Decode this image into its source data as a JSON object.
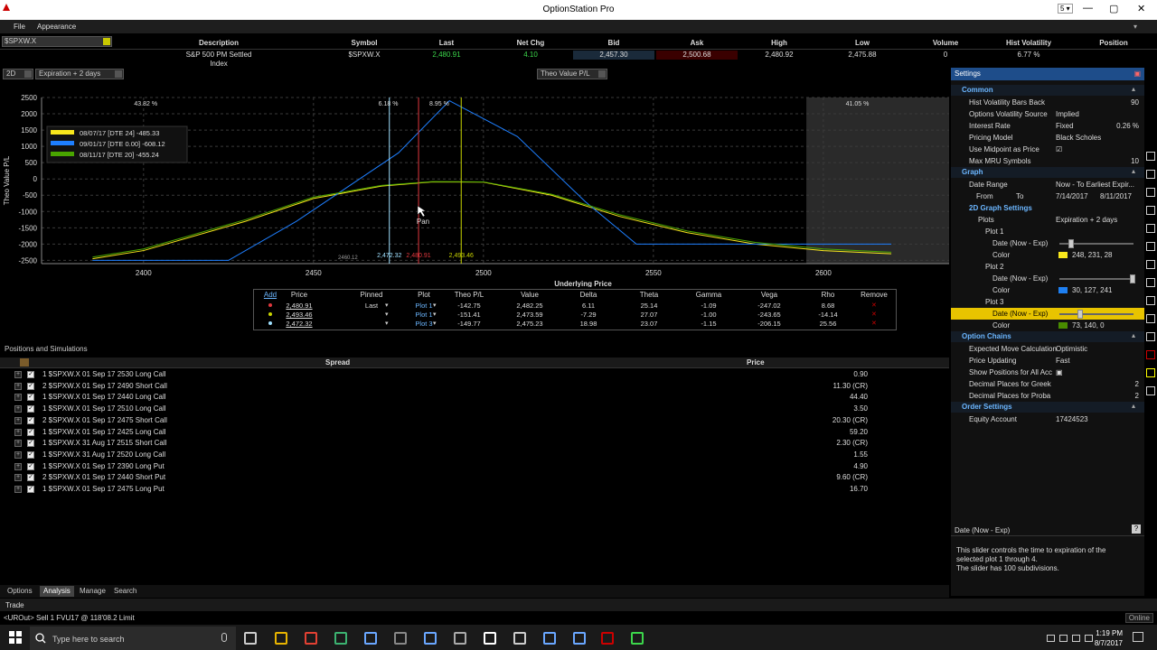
{
  "window": {
    "title": "OptionStation Pro",
    "controls": [
      "5 ▾",
      "—",
      "▢",
      "✕"
    ]
  },
  "menu": {
    "file": "File",
    "appearance": "Appearance"
  },
  "quote": {
    "symbol_select": "$SPXW.X",
    "headers": [
      "Description",
      "Symbol",
      "Last",
      "Net Chg",
      "Bid",
      "Ask",
      "High",
      "Low",
      "Volume",
      "Hist Volatility",
      "Position"
    ],
    "values": [
      "S&P 500 PM Settled Index",
      "$SPXW.X",
      "2,480.91",
      "4.10",
      "2,457.30",
      "2,500.68",
      "2,480.92",
      "2,475.88",
      "0",
      "6.77 %",
      ""
    ]
  },
  "toolbar": {
    "mode": "2D",
    "expiration": "Expiration + 2 days",
    "yaxis_select": "Theo Value P/L"
  },
  "chart_data": {
    "type": "line",
    "ylabel": "Theo Value P/L",
    "xlabel": "Underlying Price",
    "xlim": [
      2370,
      2637
    ],
    "ylim": [
      -2600,
      2500
    ],
    "yticks": [
      2500,
      2000,
      1500,
      1000,
      500,
      0,
      -500,
      -1000,
      -1500,
      -2000,
      -2500
    ],
    "xticks": [
      2400,
      2450,
      2500,
      2550,
      2600
    ],
    "series": [
      {
        "name": "08/07/17 [DTE 24] -485.33",
        "color": "#f8e71c",
        "x": [
          2385,
          2400,
          2430,
          2450,
          2470,
          2485,
          2500,
          2520,
          2540,
          2560,
          2580,
          2600,
          2620
        ],
        "y": [
          -2450,
          -2200,
          -1300,
          -600,
          -220,
          -90,
          -100,
          -500,
          -1150,
          -1650,
          -2000,
          -2200,
          -2300
        ]
      },
      {
        "name": "09/01/17 [DTE 0.00] -608.12",
        "color": "#1e7fff",
        "x": [
          2385,
          2410,
          2425,
          2445,
          2475,
          2490,
          2510,
          2530,
          2545,
          2600,
          2620
        ],
        "y": [
          -2500,
          -2500,
          -2500,
          -1300,
          800,
          2400,
          1300,
          -700,
          -2000,
          -2000,
          -2000
        ]
      },
      {
        "name": "08/11/17 [DTE 20] -455.24",
        "color": "#49a500",
        "x": [
          2385,
          2400,
          2430,
          2450,
          2470,
          2485,
          2500,
          2520,
          2540,
          2560,
          2580,
          2600,
          2620
        ],
        "y": [
          -2400,
          -2150,
          -1250,
          -560,
          -200,
          -80,
          -90,
          -470,
          -1100,
          -1600,
          -1950,
          -2150,
          -2250
        ]
      }
    ],
    "prob_labels": [
      {
        "x": 2390,
        "text": "43.82 %"
      },
      {
        "x": 2472,
        "text": "6.18 %"
      },
      {
        "x": 2487,
        "text": "8.95 %"
      },
      {
        "x": 2610,
        "text": "41.05 %"
      }
    ],
    "vlines": [
      {
        "x": 2472.32,
        "color": "#9fe0ff",
        "label": "2,472.32"
      },
      {
        "x": 2480.91,
        "color": "#e0383e",
        "label": "2,480.91"
      },
      {
        "x": 2493.46,
        "color": "#c8d400",
        "label": "2,493.46"
      }
    ],
    "min_marker": "2460.12",
    "shade_from": 2595,
    "pan_label": "Pan"
  },
  "price_table": {
    "headers": [
      "Add",
      "Price",
      "Pinned",
      "Plot",
      "Theo P/L",
      "Value",
      "Delta",
      "Theta",
      "Gamma",
      "Vega",
      "Rho",
      "Remove"
    ],
    "rows": [
      {
        "dot": "#e0383e",
        "price": "2,480.91",
        "pinned": "Last",
        "plot": "Plot 1",
        "theo": "-142.75",
        "value": "2,482.25",
        "delta": "6.11",
        "theta": "25.14",
        "gamma": "-1.09",
        "vega": "-247.02",
        "rho": "8.68"
      },
      {
        "dot": "#c8d400",
        "price": "2,493.46",
        "pinned": "",
        "plot": "Plot 1",
        "theo": "-151.41",
        "value": "2,473.59",
        "delta": "-7.29",
        "theta": "27.07",
        "gamma": "-1.00",
        "vega": "-243.65",
        "rho": "-14.14"
      },
      {
        "dot": "#9fe0ff",
        "price": "2,472.32",
        "pinned": "",
        "plot": "Plot 3",
        "theo": "-149.77",
        "value": "2,475.23",
        "delta": "18.98",
        "theta": "23.07",
        "gamma": "-1.15",
        "vega": "-206.15",
        "rho": "25.56"
      }
    ]
  },
  "positions": {
    "title": "Positions and Simulations",
    "col_spread": "Spread",
    "col_price": "Price",
    "rows": [
      {
        "label": "1 $SPXW.X 01 Sep 17 2530 Long Call",
        "price": "0.90"
      },
      {
        "label": "2 $SPXW.X 01 Sep 17 2490 Short Call",
        "price": "11.30 (CR)"
      },
      {
        "label": "1 $SPXW.X 01 Sep 17 2440 Long Call",
        "price": "44.40"
      },
      {
        "label": "1 $SPXW.X 01 Sep 17 2510 Long Call",
        "price": "3.50"
      },
      {
        "label": "2 $SPXW.X 01 Sep 17 2475 Short Call",
        "price": "20.30 (CR)"
      },
      {
        "label": "1 $SPXW.X 01 Sep 17 2425 Long Call",
        "price": "59.20"
      },
      {
        "label": "1 $SPXW.X 31 Aug 17 2515 Short Call",
        "price": "2.30 (CR)"
      },
      {
        "label": "1 $SPXW.X 31 Aug 17 2520 Long Call",
        "price": "1.55"
      },
      {
        "label": "1 $SPXW.X 01 Sep 17 2390 Long Put",
        "price": "4.90"
      },
      {
        "label": "2 $SPXW.X 01 Sep 17 2440 Short Put",
        "price": "9.60 (CR)"
      },
      {
        "label": "1 $SPXW.X 01 Sep 17 2475 Long Put",
        "price": "16.70"
      }
    ]
  },
  "settings": {
    "title": "Settings",
    "common": "Common",
    "hist_bars_back": {
      "k": "Hist Volatility Bars Back",
      "v": "90"
    },
    "vol_source": {
      "k": "Options Volatility Source",
      "v": "Implied"
    },
    "interest_rate": {
      "k": "Interest Rate",
      "v": "Fixed",
      "v2": "0.26 %"
    },
    "pricing_model": {
      "k": "Pricing Model",
      "v": "Black Scholes"
    },
    "use_midpoint": {
      "k": "Use Midpoint as Price",
      "v": "☑"
    },
    "max_mru": {
      "k": "Max MRU Symbols",
      "v": "10"
    },
    "graph": "Graph",
    "date_range": {
      "k": "Date Range",
      "v": "Now - To Earliest Expir..."
    },
    "from_to": {
      "k": "From",
      "k2": "To",
      "v": "7/14/2017",
      "v2": "8/11/2017"
    },
    "graph2d": {
      "k": "2D Graph Settings"
    },
    "plots": {
      "k": "Plots",
      "v": "Expiration + 2 days"
    },
    "plot1": "Plot 1",
    "plot2": "Plot 2",
    "plot3": "Plot 3",
    "date_now_exp": "Date (Now - Exp)",
    "color": "Color",
    "plot1_color": {
      "v": "248, 231, 28",
      "hex": "#f8e71c"
    },
    "plot2_color": {
      "v": "30, 127, 241",
      "hex": "#1e7ff1"
    },
    "plot3_color": {
      "v": "73, 140, 0",
      "hex": "#498c00"
    },
    "option_chains": "Option Chains",
    "expected_move": {
      "k": "Expected Move Calculation",
      "v": "Optimistic"
    },
    "price_updating": {
      "k": "Price Updating",
      "v": "Fast"
    },
    "show_positions": {
      "k": "Show Positions for All Acc",
      "v": "▣"
    },
    "dec_greek": {
      "k": "Decimal Places for Greek",
      "v": "2"
    },
    "dec_prob": {
      "k": "Decimal Places for Proba",
      "v": "2"
    },
    "order_settings": "Order Settings",
    "equity_account": {
      "k": "Equity Account",
      "v": "17424523"
    }
  },
  "help": {
    "title": "Date (Now - Exp)",
    "text1": "This slider controls the time to expiration of the",
    "text2": "selected plot 1 through 4.",
    "text3": "The slider has 100 subdivisions."
  },
  "tabs": [
    "Options",
    "Analysis",
    "Manage",
    "Search"
  ],
  "trade": {
    "label": "Trade",
    "status": "<UROut> Sell 1 FVU17 @ 118'08.2 Limit",
    "online": "Online"
  },
  "taskbar": {
    "search": "Type here to search",
    "time": "1:19 PM",
    "date": "8/7/2017"
  }
}
